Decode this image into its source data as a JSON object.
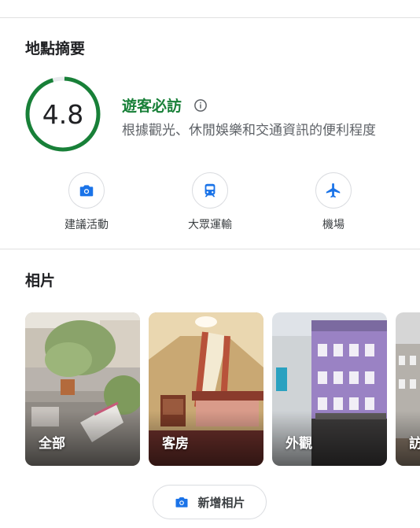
{
  "summary": {
    "title": "地點摘要",
    "score": "4.8",
    "score_fraction": 0.96,
    "score_label": "遊客必訪",
    "score_description": "根據觀光、休閒娛樂和交通資訊的便利程度",
    "ring_color": "#188038",
    "categories": [
      {
        "label": "建議活動",
        "icon": "camera-icon"
      },
      {
        "label": "大眾運輸",
        "icon": "train-icon"
      },
      {
        "label": "機場",
        "icon": "airplane-icon"
      }
    ]
  },
  "photos": {
    "title": "相片",
    "items": [
      {
        "label": "全部"
      },
      {
        "label": "客房"
      },
      {
        "label": "外觀"
      },
      {
        "label": "訪"
      }
    ],
    "add_button": "新增相片"
  },
  "accent_color": "#1a73e8"
}
